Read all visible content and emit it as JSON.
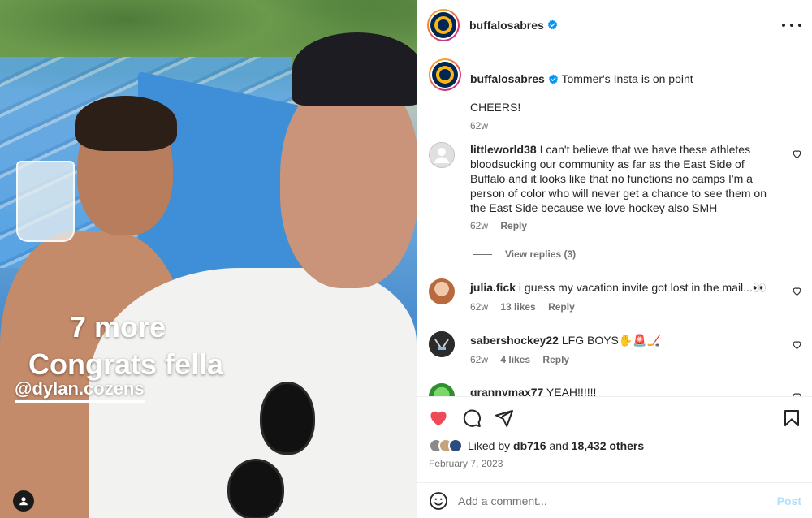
{
  "photo": {
    "story_more": "7 more",
    "story_congrats": "Congrats fella",
    "story_mention": "@dylan.cozens"
  },
  "header": {
    "username": "buffalosabres",
    "more_icon": "more-horizontal-icon"
  },
  "caption": {
    "username": "buffalosabres",
    "text": "Tommer's Insta is on point",
    "line2": "CHEERS!",
    "time": "62w"
  },
  "comments": [
    {
      "username": "littleworld38",
      "text": "I can't believe that we have these athletes bloodsucking our community as far as the East Side of Buffalo and it looks like that no functions no camps I'm a person of color who will never get a chance to see them on the East Side because we love hockey also SMH",
      "time": "62w",
      "likes": "",
      "reply": "Reply",
      "view_replies": "View replies (3)"
    },
    {
      "username": "julia.fick",
      "text": "i guess my vacation invite got lost in the mail...👀",
      "time": "62w",
      "likes": "13 likes",
      "reply": "Reply"
    },
    {
      "username": "sabershockey22",
      "text": "LFG BOYS✋🚨🏒",
      "time": "62w",
      "likes": "4 likes",
      "reply": "Reply"
    },
    {
      "username": "grannymax77",
      "text": "YEAH!!!!!!"
    }
  ],
  "actions": {
    "like_icon": "heart-filled-icon",
    "comment_icon": "comment-icon",
    "share_icon": "paper-plane-icon",
    "save_icon": "bookmark-icon"
  },
  "likes": {
    "prefix": "Liked by",
    "user": "db716",
    "middle": "and",
    "others": "18,432 others"
  },
  "date": "February 7, 2023",
  "add_comment": {
    "placeholder": "Add a comment...",
    "post_label": "Post"
  },
  "colors": {
    "like_red": "#ed4956",
    "verified_blue": "#0095f6",
    "post_disabled": "#b2dffc",
    "sabres_navy": "#002654",
    "sabres_gold": "#fcb514"
  }
}
